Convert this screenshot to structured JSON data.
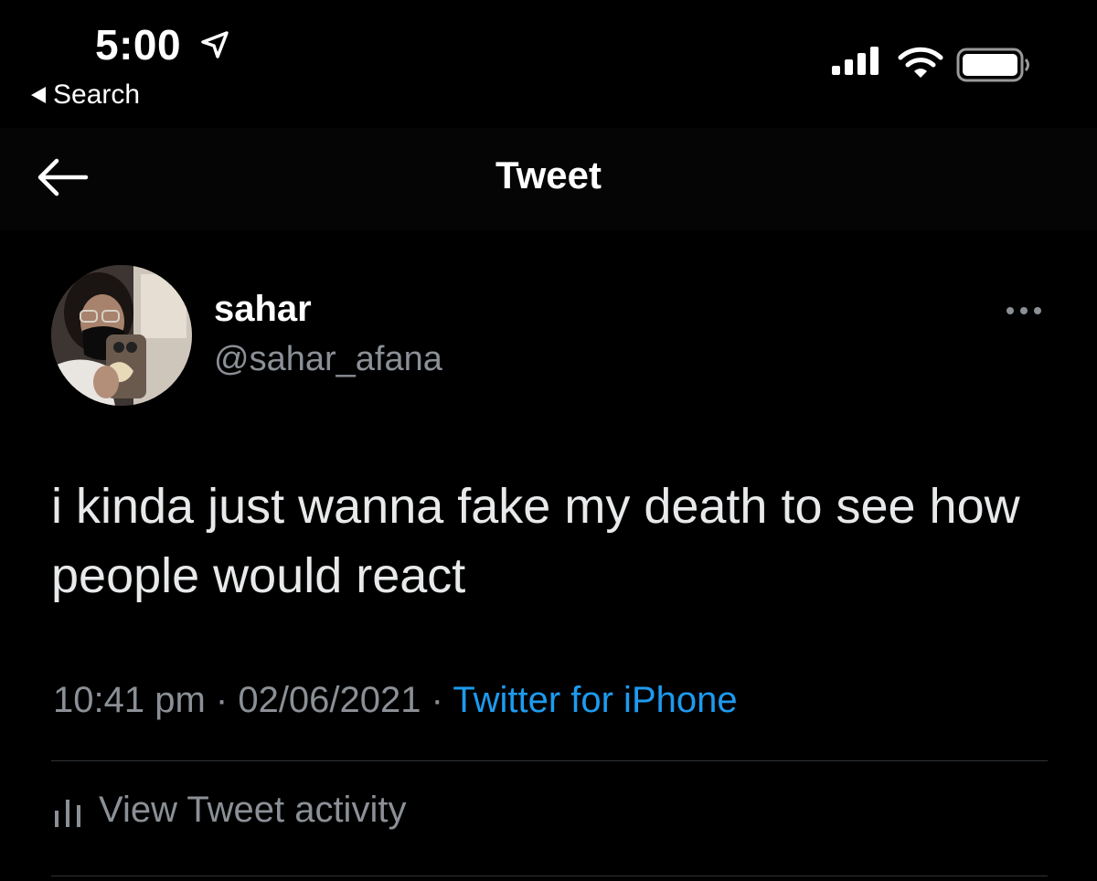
{
  "status_bar": {
    "time": "5:00",
    "back_app_label": "Search"
  },
  "nav": {
    "title": "Tweet"
  },
  "tweet": {
    "display_name": "sahar",
    "handle": "@sahar_afana",
    "text": "i kinda just wanna fake my death to see how people would react",
    "time": "10:41 pm",
    "separator": " · ",
    "date": "02/06/2021",
    "source": "Twitter for iPhone"
  },
  "activity": {
    "label": "View Tweet activity"
  },
  "colors": {
    "background": "#000000",
    "text": "#e7e9ea",
    "secondary": "#8b9096",
    "link": "#1d9bf0"
  }
}
